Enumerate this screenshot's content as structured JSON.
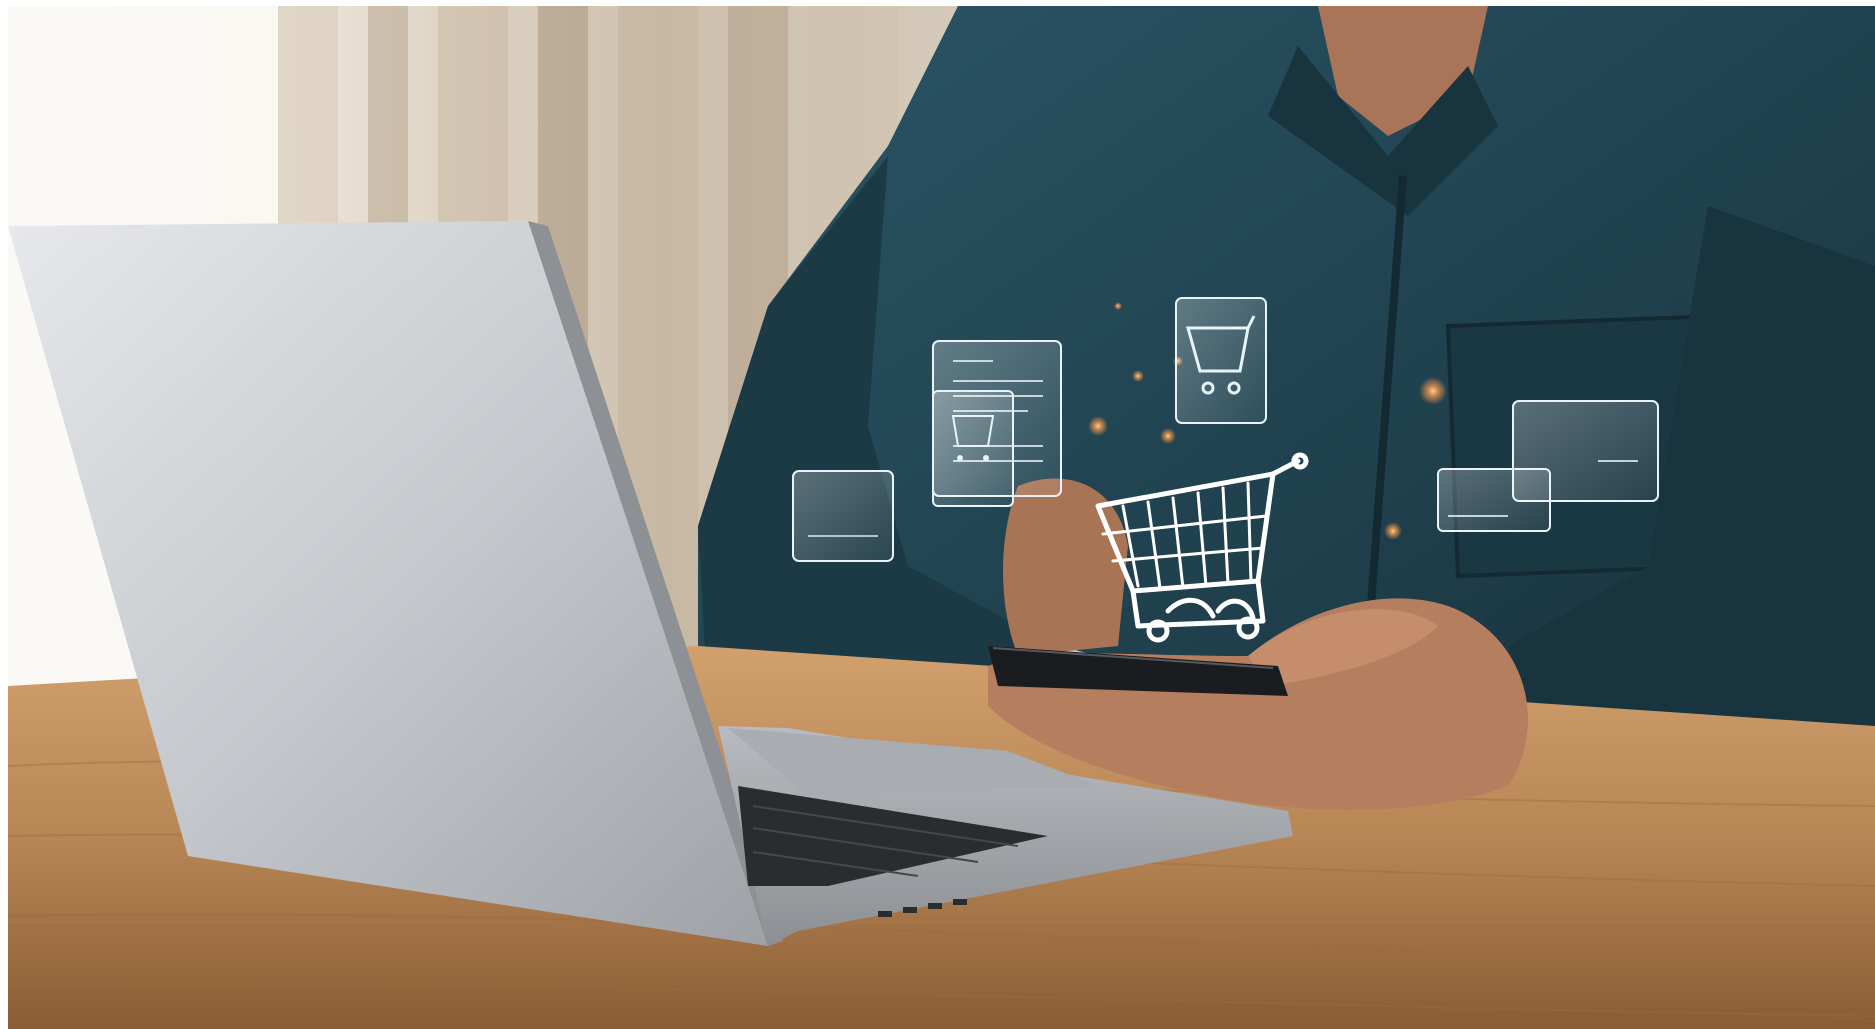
{
  "image": {
    "subject": "shopping-cart-hologram-over-phone",
    "palette": {
      "wall": "#d9cfc1",
      "curtain": "#b8a78f",
      "shirt": "#1f3f4c",
      "shirt_shadow": "#142c36",
      "skin": "#b57f5f",
      "desk": "#b88655",
      "laptop": "#c9ccd0",
      "keyboard": "#2a2c30",
      "phone": "#1b1c1f",
      "hologram": "#ffffff",
      "glow": "#ff9c4a"
    }
  }
}
